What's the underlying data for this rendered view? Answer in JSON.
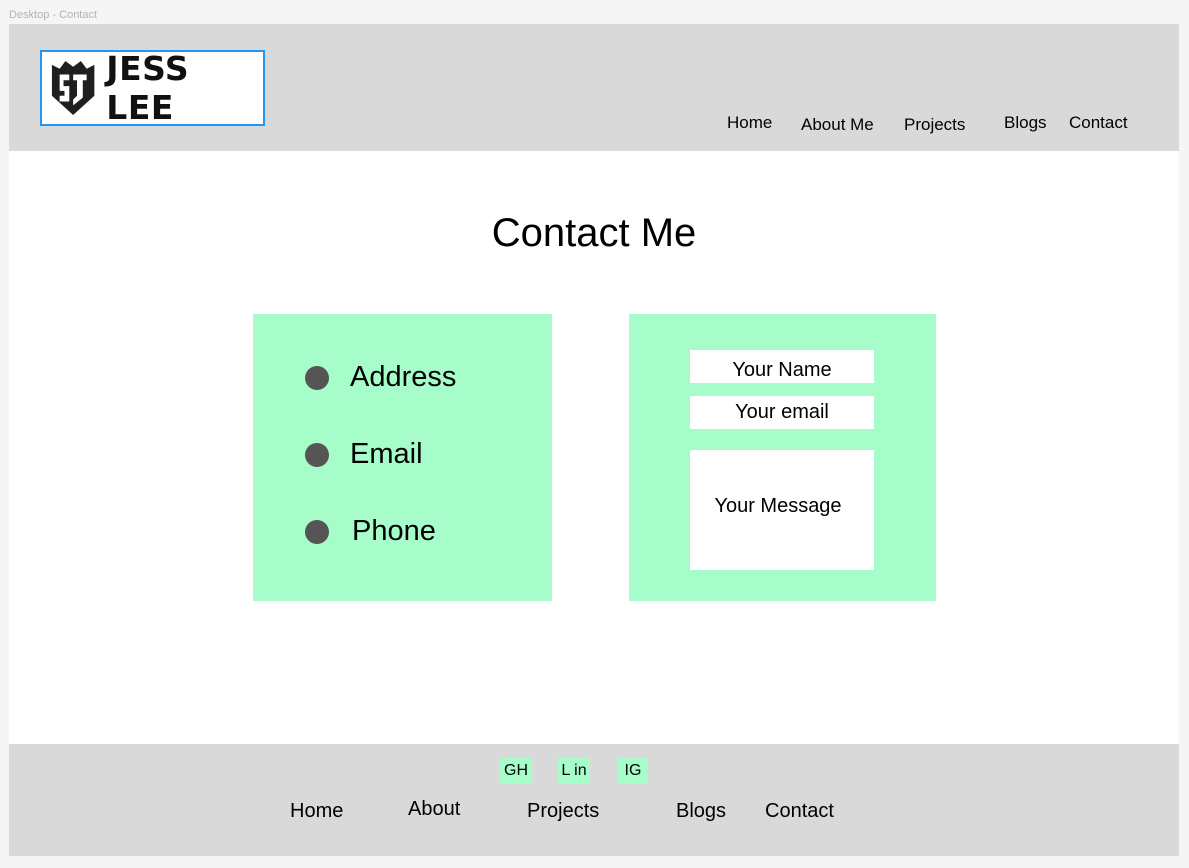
{
  "frame_label": "Desktop - Contact",
  "header": {
    "logo_text": "JESS LEE",
    "nav": [
      "Home",
      "About Me",
      "Projects",
      "Blogs",
      "Contact"
    ]
  },
  "main": {
    "title": "Contact Me",
    "info": {
      "address_label": "Address",
      "email_label": "Email",
      "phone_label": "Phone"
    },
    "form": {
      "name_placeholder": "Your Name",
      "email_placeholder": "Your email",
      "message_placeholder": "Your Message"
    }
  },
  "footer": {
    "social": [
      "GH",
      "L in",
      "IG"
    ],
    "nav": [
      "Home",
      "About",
      "Projects",
      "Blogs",
      "Contact"
    ]
  },
  "colors": {
    "accent_green": "#a6fdca",
    "header_gray": "#d9d9d9",
    "logo_border": "#2196f3",
    "bullet": "#555555"
  }
}
